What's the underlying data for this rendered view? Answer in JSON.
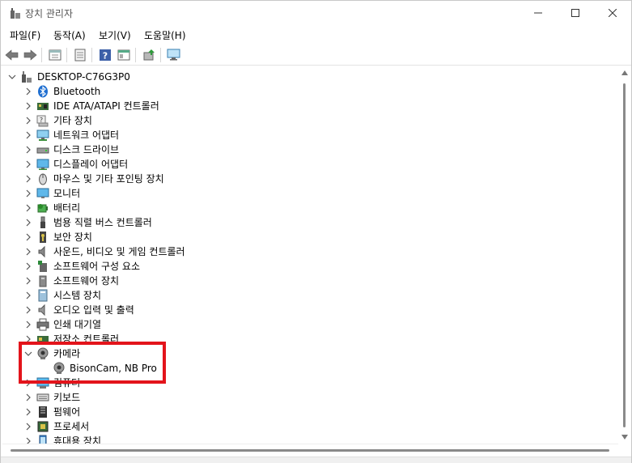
{
  "window": {
    "title": "장치 관리자"
  },
  "menu": [
    "파일(F)",
    "동작(A)",
    "보기(V)",
    "도움말(H)"
  ],
  "toolbar": [
    "back-icon",
    "forward-icon",
    "properties-pane-icon",
    "device-properties-icon",
    "help-icon",
    "view-icon",
    "update-driver-icon",
    "scan-hardware-icon"
  ],
  "tree": {
    "root": "DESKTOP-C76G3P0",
    "items": [
      {
        "label": "Bluetooth",
        "icon": "bluetooth-icon",
        "expanded": false
      },
      {
        "label": "IDE ATA/ATAPI 컨트롤러",
        "icon": "ide-controller-icon",
        "expanded": false
      },
      {
        "label": "기타 장치",
        "icon": "other-devices-icon",
        "expanded": false
      },
      {
        "label": "네트워크 어댑터",
        "icon": "network-adapter-icon",
        "expanded": false
      },
      {
        "label": "디스크 드라이브",
        "icon": "disk-drive-icon",
        "expanded": false
      },
      {
        "label": "디스플레이 어댑터",
        "icon": "display-adapter-icon",
        "expanded": false
      },
      {
        "label": "마우스 및 기타 포인팅 장치",
        "icon": "mouse-icon",
        "expanded": false
      },
      {
        "label": "모니터",
        "icon": "monitor-icon",
        "expanded": false
      },
      {
        "label": "배터리",
        "icon": "battery-icon",
        "expanded": false
      },
      {
        "label": "범용 직렬 버스 컨트롤러",
        "icon": "usb-icon",
        "expanded": false
      },
      {
        "label": "보안 장치",
        "icon": "security-device-icon",
        "expanded": false
      },
      {
        "label": "사운드, 비디오 및 게임 컨트롤러",
        "icon": "speaker-icon",
        "expanded": false
      },
      {
        "label": "소프트웨어 구성 요소",
        "icon": "software-component-icon",
        "expanded": false
      },
      {
        "label": "소프트웨어 장치",
        "icon": "software-device-icon",
        "expanded": false
      },
      {
        "label": "시스템 장치",
        "icon": "system-device-icon",
        "expanded": false
      },
      {
        "label": "오디오 입력 및 출력",
        "icon": "audio-icon",
        "expanded": false
      },
      {
        "label": "인쇄 대기열",
        "icon": "printer-icon",
        "expanded": false
      },
      {
        "label": "저장소 컨트롤러",
        "icon": "storage-controller-icon",
        "expanded": false
      },
      {
        "label": "카메라",
        "icon": "camera-icon",
        "expanded": true,
        "children": [
          "BisonCam, NB Pro"
        ]
      },
      {
        "label": "컴퓨터",
        "icon": "computer-icon",
        "expanded": false
      },
      {
        "label": "키보드",
        "icon": "keyboard-icon",
        "expanded": false
      },
      {
        "label": "펌웨어",
        "icon": "firmware-icon",
        "expanded": false
      },
      {
        "label": "프로세서",
        "icon": "processor-icon",
        "expanded": false
      },
      {
        "label": "휴대용 장치",
        "icon": "portable-device-icon",
        "expanded": false
      }
    ]
  },
  "colors": {
    "highlight": "#e3141b",
    "accent": "#0078d7"
  }
}
